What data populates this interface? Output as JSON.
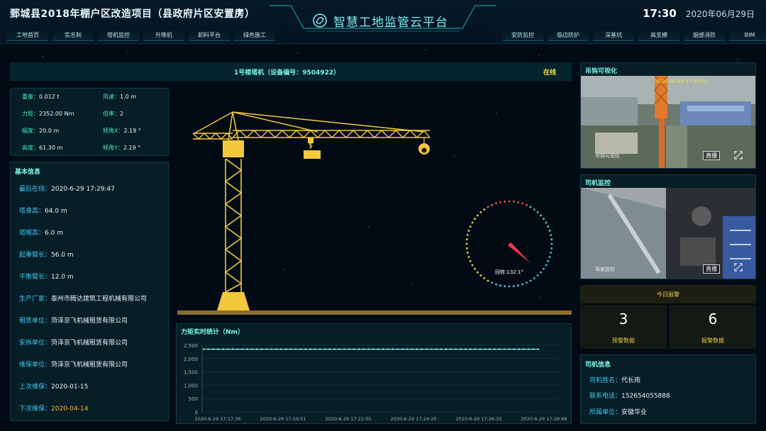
{
  "header": {
    "project_title": "鄄城县2018年棚户区改造项目（县政府片区安置房）",
    "platform_title": "智慧工地监管云平台",
    "time": "17:30",
    "date": "2020年06月29日",
    "nav_left": [
      "工地首页",
      "实名制",
      "塔机监控",
      "升降机",
      "卸料平台",
      "绿色施工"
    ],
    "nav_right": [
      "安防监控",
      "临边防护",
      "深基坑",
      "高支模",
      "烟感消防",
      "BIM"
    ]
  },
  "crane": {
    "name": "1号楼塔机（设备编号：9504922）",
    "status": "在线",
    "status_color": "#f2e23a",
    "rotation_label": "回转:132.1°",
    "rotation_deg": 132.1
  },
  "metrics": [
    {
      "key": "重量：",
      "value": "0.012 t"
    },
    {
      "key": "风速：",
      "value": "1.0 m"
    },
    {
      "key": "力矩：",
      "value": "2352.00 Nm"
    },
    {
      "key": "倍率：",
      "value": "2"
    },
    {
      "key": "幅度：",
      "value": "20.0 m"
    },
    {
      "key": "倾角X：",
      "value": "2.19 °"
    },
    {
      "key": "高度：",
      "value": "61.30 m"
    },
    {
      "key": "倾角Y：",
      "value": "2.19 °"
    }
  ],
  "basic_info": {
    "title": "基本信息",
    "rows": [
      {
        "key": "最后在线：",
        "value": "2020-6-29 17:29:47"
      },
      {
        "key": "塔身高：",
        "value": "64.0 m"
      },
      {
        "key": "塔帽高：",
        "value": "6.0 m"
      },
      {
        "key": "起重臂长：",
        "value": "56.0 m"
      },
      {
        "key": "平衡臂长：",
        "value": "12.0 m"
      },
      {
        "key": "生产厂家：",
        "value": "泰州市腾达建筑工程机械有限公司"
      },
      {
        "key": "租赁单位：",
        "value": "菏泽京飞机械租赁有限公司"
      },
      {
        "key": "安拆单位：",
        "value": "菏泽京飞机械租赁有限公司"
      },
      {
        "key": "维保单位：",
        "value": "菏泽京飞机械租赁有限公司"
      },
      {
        "key": "上次维保：",
        "value": "2020-01-15"
      },
      {
        "key": "下次维保：",
        "value": "2020-04-14"
      }
    ]
  },
  "chart_data": {
    "type": "line",
    "title": "力矩实时统计（Nm）",
    "xlabel": "",
    "ylabel": "",
    "ylim": [
      0,
      2500
    ],
    "y_ticks": [
      "0",
      "500",
      "1,000",
      "1,500",
      "2,000",
      "2,500"
    ],
    "x_tick_labels": [
      "2020-6-29 17:17:36",
      "2020-6-29 17:19:51",
      "2020-6-29 17:22:05",
      "2020-6-29 17:24:20",
      "2020-6-29 17:26:33",
      "2020-6-29 17:28:48"
    ],
    "point_count": 70,
    "value": 2352,
    "grid": true,
    "line_color": "#7af4ec"
  },
  "cameras": [
    {
      "title": "吊钩可视化",
      "label": "吊钩可视化",
      "button": "直播",
      "overlay_time": "2020-06-29 17:33:51"
    },
    {
      "title": "司机监控",
      "label": "驾驶监控",
      "button": "直播"
    }
  ],
  "alarms": {
    "title": "今日报警",
    "warning_count": "3",
    "warning_label": "预警数据",
    "alarm_count": "6",
    "alarm_label": "报警数据"
  },
  "driver": {
    "title": "司机信息",
    "rows": [
      {
        "key": "司机姓名：",
        "value": "代长雨"
      },
      {
        "key": "联系电话：",
        "value": "152654055888"
      },
      {
        "key": "所属单位：",
        "value": "安徽华业"
      }
    ]
  }
}
